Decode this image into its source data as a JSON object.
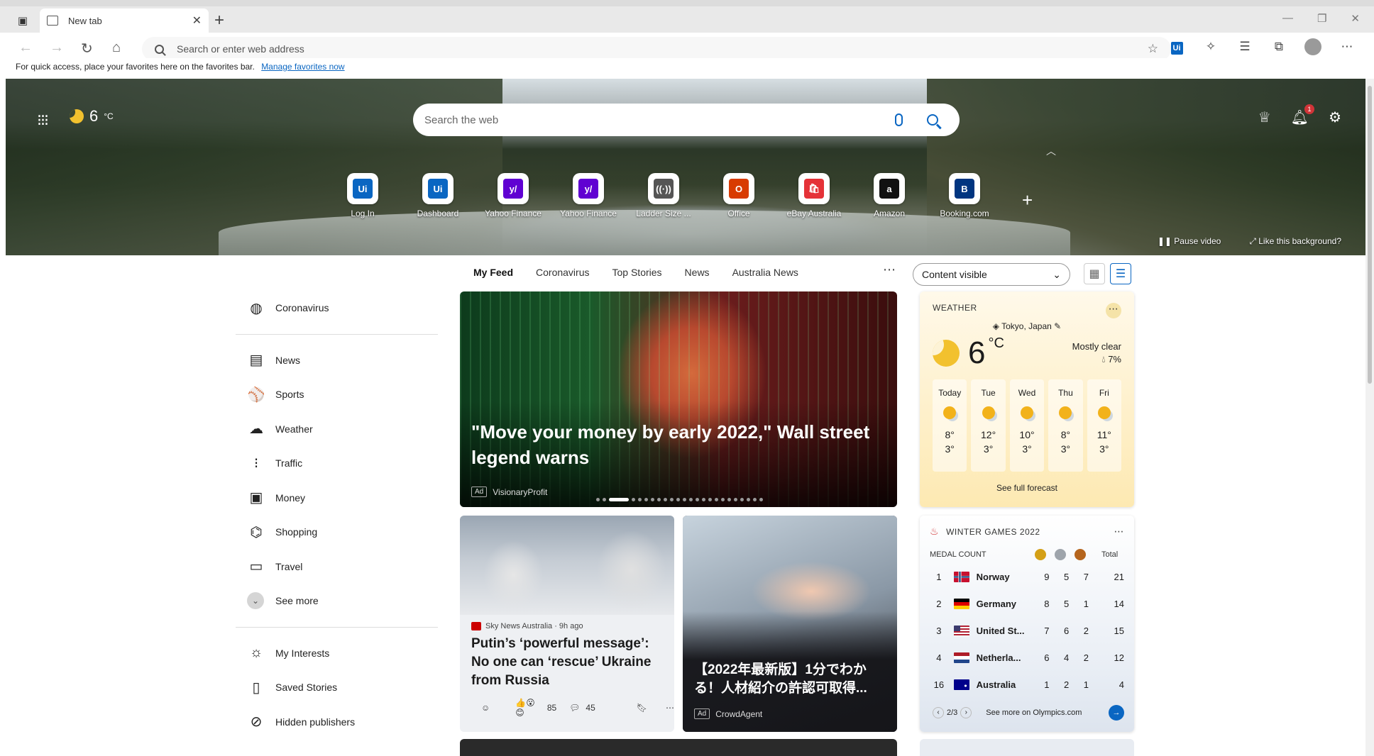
{
  "browser": {
    "tab_title": "New tab",
    "address_placeholder": "Search or enter web address",
    "favbar_text": "For quick access, place your favorites here on the favorites bar.",
    "favbar_link": "Manage favorites now",
    "win_minimize": "—",
    "win_restore": "❐",
    "win_close": "✕"
  },
  "hero": {
    "temp": "6",
    "unit": "°C",
    "search_placeholder": "Search the web",
    "notification_count": "1",
    "pause_video": "Pause video",
    "like_background": "Like this background?",
    "quicklinks": [
      {
        "label": "Log In",
        "icon_text": "Ui",
        "color": "#0a66c2"
      },
      {
        "label": "Dashboard",
        "icon_text": "Ui",
        "color": "#0a66c2"
      },
      {
        "label": "Yahoo Finance",
        "icon_text": "y/",
        "color": "#6001d2"
      },
      {
        "label": "Yahoo Finance",
        "icon_text": "y/",
        "color": "#6001d2"
      },
      {
        "label": "Ladder Size ...",
        "icon_text": "((·))",
        "color": "#555555"
      },
      {
        "label": "Office",
        "icon_text": "O",
        "color": "#d83b01"
      },
      {
        "label": "eBay Australia",
        "icon_text": "🛍",
        "color": "#e53238"
      },
      {
        "label": "Amazon",
        "icon_text": "a",
        "color": "#111111"
      },
      {
        "label": "Booking.com",
        "icon_text": "B",
        "color": "#003580"
      }
    ]
  },
  "feed": {
    "tabs": [
      "My Feed",
      "Coronavirus",
      "Top Stories",
      "News",
      "Australia News"
    ],
    "content_select": "Content visible"
  },
  "leftnav": {
    "top": [
      {
        "label": "Coronavirus",
        "icon": "globe-icon"
      }
    ],
    "main": [
      {
        "label": "News",
        "icon": "news-icon"
      },
      {
        "label": "Sports",
        "icon": "sports-icon"
      },
      {
        "label": "Weather",
        "icon": "cloud-icon"
      },
      {
        "label": "Traffic",
        "icon": "traffic-light-icon"
      },
      {
        "label": "Money",
        "icon": "money-icon"
      },
      {
        "label": "Shopping",
        "icon": "tag-icon"
      },
      {
        "label": "Travel",
        "icon": "suitcase-icon"
      },
      {
        "label": "See more",
        "icon": "chevron-down-icon"
      }
    ],
    "personal": [
      {
        "label": "My Interests",
        "icon": "sun-icon"
      },
      {
        "label": "Saved Stories",
        "icon": "bookmark-icon"
      },
      {
        "label": "Hidden publishers",
        "icon": "block-icon"
      }
    ]
  },
  "main_card": {
    "headline": "\"Move your money by early 2022,\" Wall street legend warns",
    "ad": "Ad",
    "source": "VisionaryProfit"
  },
  "weather": {
    "title": "WEATHER",
    "location": "Tokyo, Japan",
    "temp": "6",
    "unit": "°C",
    "condition": "Mostly clear",
    "precip": "7%",
    "days": [
      {
        "day": "Today",
        "hi": "8°",
        "lo": "3°"
      },
      {
        "day": "Tue",
        "hi": "12°",
        "lo": "3°"
      },
      {
        "day": "Wed",
        "hi": "10°",
        "lo": "3°"
      },
      {
        "day": "Thu",
        "hi": "8°",
        "lo": "3°"
      },
      {
        "day": "Fri",
        "hi": "11°",
        "lo": "3°"
      }
    ],
    "full_forecast": "See full forecast"
  },
  "news1": {
    "source": "Sky News Australia · 9h ago",
    "title": "Putin’s ‘powerful message’: No one can ‘rescue’ Ukraine from Russia",
    "reactions": "85",
    "comments": "45"
  },
  "news2": {
    "title": "【2022年最新版】1分でわかる！人材紹介の許認可取得...",
    "ad": "Ad",
    "source": "CrowdAgent"
  },
  "games": {
    "title": "WINTER GAMES 2022",
    "medal_count": "MEDAL COUNT",
    "total": "Total",
    "medal_colors": [
      "#d4a017",
      "#9ea4ab",
      "#b5651d"
    ],
    "rows": [
      {
        "rank": "1",
        "name": "Norway",
        "g": "9",
        "s": "5",
        "b": "7",
        "total": "21"
      },
      {
        "rank": "2",
        "name": "Germany",
        "g": "8",
        "s": "5",
        "b": "1",
        "total": "14"
      },
      {
        "rank": "3",
        "name": "United St...",
        "g": "7",
        "s": "6",
        "b": "2",
        "total": "15"
      },
      {
        "rank": "4",
        "name": "Netherla...",
        "g": "6",
        "s": "4",
        "b": "2",
        "total": "12"
      },
      {
        "rank": "16",
        "name": "Australia",
        "g": "1",
        "s": "2",
        "b": "1",
        "total": "4"
      }
    ],
    "page": "2/3",
    "see_more": "See more on Olympics.com"
  }
}
